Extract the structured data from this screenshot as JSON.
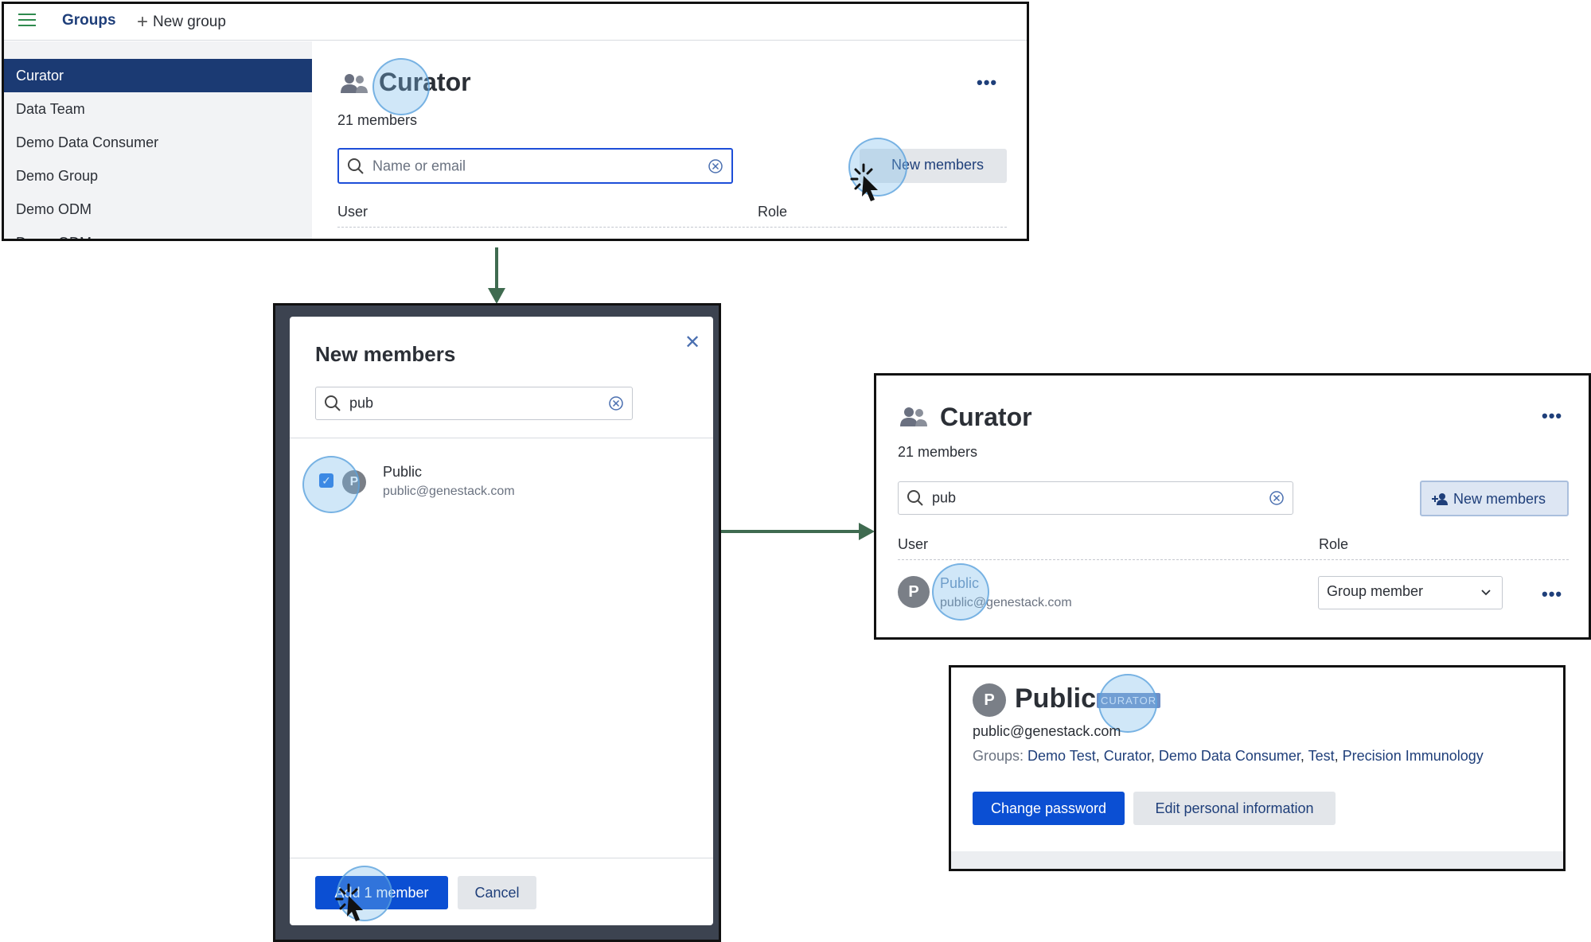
{
  "panel1": {
    "topbar": {
      "groups_label": "Groups",
      "new_group_label": "New group"
    },
    "sidebar": {
      "items": [
        {
          "label": "Curator",
          "active": true
        },
        {
          "label": "Data Team"
        },
        {
          "label": "Demo Data Consumer"
        },
        {
          "label": "Demo Group"
        },
        {
          "label": "Demo ODM"
        },
        {
          "label": "Demo ODM new"
        }
      ]
    },
    "group_title": "Curator",
    "members_count": "21 members",
    "search": {
      "placeholder": "Name or email",
      "value": ""
    },
    "new_members_label": "New members",
    "columns": {
      "user": "User",
      "role": "Role"
    }
  },
  "panel2": {
    "title": "New members",
    "search_value": "pub",
    "result": {
      "name": "Public",
      "email": "public@genestack.com",
      "avatar_letter": "P",
      "checked": true
    },
    "add_label": "Add 1 member",
    "cancel_label": "Cancel"
  },
  "panel3": {
    "group_title": "Curator",
    "members_count": "21 members",
    "search_value": "pub",
    "new_members_label": "New members",
    "columns": {
      "user": "User",
      "role": "Role"
    },
    "member": {
      "name": "Public",
      "email": "public@genestack.com",
      "avatar_letter": "P",
      "role": "Group member"
    }
  },
  "panel4": {
    "avatar_letter": "P",
    "name": "Public",
    "badge": "CURATOR",
    "email": "public@genestack.com",
    "groups_prefix": "Groups:",
    "groups": [
      "Demo Test",
      "Curator",
      "Demo Data Consumer",
      "Test",
      "Precision Immunology"
    ],
    "change_password_label": "Change password",
    "edit_info_label": "Edit personal information"
  },
  "icons": {
    "menu": "hamburger-icon",
    "plus": "plus-icon",
    "group": "group-icon",
    "search": "search-icon",
    "clear": "clear-circle-icon",
    "add_user": "add-user-icon",
    "more": "more-horizontal-icon",
    "close": "close-icon",
    "chevron": "chevron-down-icon",
    "check": "check-icon",
    "cursor": "click-cursor-icon"
  },
  "colors": {
    "primary": "#0b4fd3",
    "nav_active": "#1b3a73",
    "link": "#1f3f7a",
    "highlight": "#78b9eb",
    "arrow": "#3f6b50"
  }
}
